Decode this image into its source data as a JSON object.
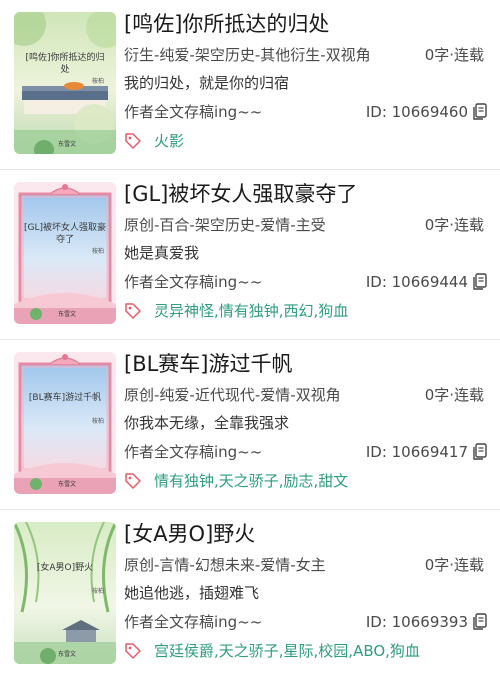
{
  "colors": {
    "tag_text": "#2e9e7e",
    "tag_icon": "#e85a6a",
    "divider": "#e6e6e6"
  },
  "books": [
    {
      "cover_style": "green-wall",
      "cover_title": "[鸣佐]你所抵达的归处",
      "cover_author": "桉柏",
      "cover_publisher": "东雪文",
      "title": "[鸣佐]你所抵达的归处",
      "meta": "衍生-纯爱-架空历史-其他衍生-双视角",
      "stat": "0字·连载",
      "summary": "我的归处，就是你的归宿",
      "status": "作者全文存稿ing~~",
      "id": "ID: 10669460",
      "tags": "火影"
    },
    {
      "cover_style": "pink-frame",
      "cover_title": "[GL]被坏女人强取豪夺了",
      "cover_author": "桉柏",
      "cover_publisher": "东雪文",
      "title": "[GL]被坏女人强取豪夺了",
      "meta": "原创-百合-架空历史-爱情-主受",
      "stat": "0字·连载",
      "summary": "她是真爱我",
      "status": "作者全文存稿ing~~",
      "id": "ID: 10669444",
      "tags": "灵异神怪,情有独钟,西幻,狗血"
    },
    {
      "cover_style": "pink-frame",
      "cover_title": "[BL赛车]游过千帆",
      "cover_author": "桉柏",
      "cover_publisher": "东雪文",
      "title": "[BL赛车]游过千帆",
      "meta": "原创-纯爱-近代现代-爱情-双视角",
      "stat": "0字·连载",
      "summary": "你我本无缘，全靠我强求",
      "status": "作者全文存稿ing~~",
      "id": "ID: 10669417",
      "tags": "情有独钟,天之骄子,励志,甜文"
    },
    {
      "cover_style": "green-willow",
      "cover_title": "[女A男O]野火",
      "cover_author": "桉柏",
      "cover_publisher": "东雪文",
      "title": "[女A男O]野火",
      "meta": "原创-言情-幻想未来-爱情-女主",
      "stat": "0字·连载",
      "summary": "她追他逃，插翅难飞",
      "status": "作者全文存稿ing~~",
      "id": "ID: 10669393",
      "tags": "宫廷侯爵,天之骄子,星际,校园,ABO,狗血"
    }
  ]
}
